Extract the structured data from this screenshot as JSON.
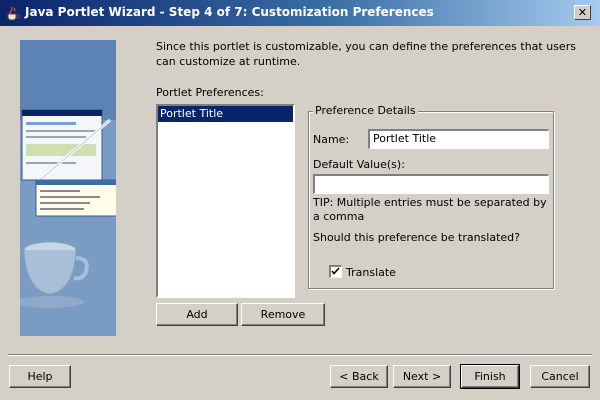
{
  "window": {
    "title": "Java Portlet Wizard - Step 4 of 7: Customization Preferences",
    "close_glyph": "✕"
  },
  "intro": {
    "text": "Since this portlet is customizable, you can define the preferences that users can customize at runtime."
  },
  "preferences": {
    "label": "Portlet Preferences:",
    "items": [
      "Portlet Title"
    ],
    "add_label": "Add",
    "remove_label": "Remove"
  },
  "details": {
    "legend": "Preference Details",
    "name_label": "Name:",
    "name_value": "Portlet Title",
    "default_label": "Default Value(s):",
    "default_value": "",
    "tip": "TIP: Multiple entries must be separated by a comma",
    "translate_question": "Should this preference be translated?",
    "translate_label": "Translate",
    "translate_checked": true
  },
  "footer": {
    "help": "Help",
    "back": "< Back",
    "next": "Next >",
    "finish": "Finish",
    "cancel": "Cancel"
  },
  "colors": {
    "dialog_bg": "#d4d0c8",
    "title_dark": "#0a246a",
    "title_light": "#a6caf0",
    "selection": "#0a246a"
  }
}
